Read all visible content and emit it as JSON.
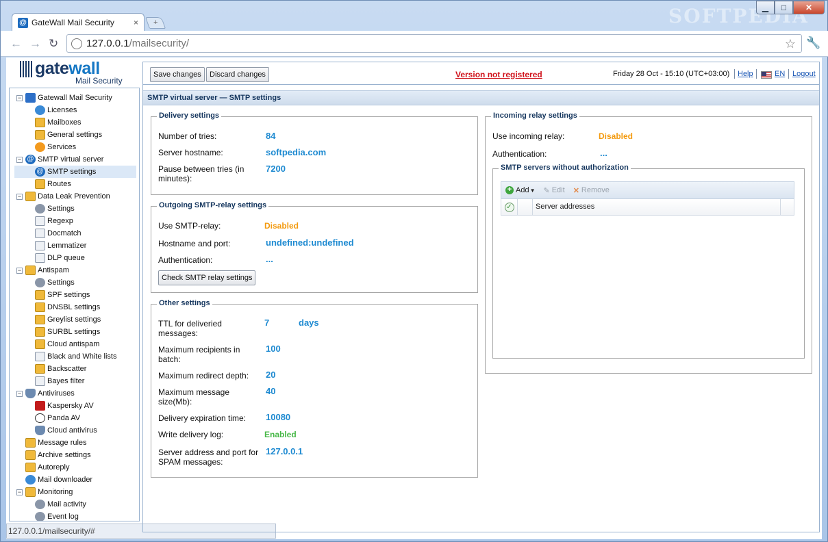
{
  "browser": {
    "tab_title": "GateWall Mail Security",
    "tab_close": "×",
    "new_tab": "+",
    "min": "▁",
    "max": "□",
    "close": "✕",
    "watermark": "SOFTPEDIA",
    "back": "←",
    "forward": "→",
    "reload": "↻",
    "url_host": "127.0.0.1",
    "url_path": "/mailsecurity/",
    "star": "☆",
    "wrench": "🔧",
    "status_url": "127.0.0.1/mailsecurity/#"
  },
  "logo": {
    "name_a": "gate",
    "name_b": "wall",
    "sub": "Mail Security"
  },
  "header": {
    "save": "Save changes",
    "discard": "Discard changes",
    "not_registered": "Version not registered",
    "datetime": "Friday 28 Oct - 15:10 (UTC+03:00)",
    "help": "Help",
    "lang": "EN",
    "logout": "Logout"
  },
  "tree": {
    "gatewall": "Gatewall Mail Security",
    "licenses": "Licenses",
    "mailboxes": "Mailboxes",
    "general": "General settings",
    "services": "Services",
    "smtp": "SMTP virtual server",
    "smtp_settings": "SMTP settings",
    "routes": "Routes",
    "dlp": "Data Leak Prevention",
    "dlp_settings": "Settings",
    "regexp": "Regexp",
    "docmatch": "Docmatch",
    "lemmatizer": "Lemmatizer",
    "dlp_queue": "DLP queue",
    "antispam": "Antispam",
    "as_settings": "Settings",
    "spf": "SPF settings",
    "dnsbl": "DNSBL settings",
    "greylist": "Greylist settings",
    "surbl": "SURBL settings",
    "cloud_antispam": "Cloud antispam",
    "bwlists": "Black and White lists",
    "backscatter": "Backscatter",
    "bayes": "Bayes filter",
    "antiviruses": "Antiviruses",
    "kaspersky": "Kaspersky AV",
    "panda": "Panda AV",
    "cloud_av": "Cloud antivirus",
    "message_rules": "Message rules",
    "archive": "Archive settings",
    "autoreply": "Autoreply",
    "downloader": "Mail downloader",
    "monitoring": "Monitoring",
    "mail_activity": "Mail activity",
    "event_log": "Event log"
  },
  "section_title": "SMTP virtual server — SMTP settings",
  "delivery": {
    "legend": "Delivery settings",
    "tries_label": "Number of tries:",
    "tries": "84",
    "host_label": "Server hostname:",
    "host": "softpedia.com",
    "pause_label": "Pause between tries (in minutes):",
    "pause": "7200"
  },
  "outgoing": {
    "legend": "Outgoing SMTP-relay settings",
    "use_label": "Use SMTP-relay:",
    "use": "Disabled",
    "hp_label": "Hostname and port:",
    "hp": "undefined:undefined",
    "auth_label": "Authentication:",
    "auth": "...",
    "check_btn": "Check SMTP relay settings"
  },
  "other": {
    "legend": "Other settings",
    "ttl_label": "TTL for deliveried messages:",
    "ttl": "7",
    "ttl_unit": "days",
    "maxrcpt_label": "Maximum recipients in batch:",
    "maxrcpt": "100",
    "redirect_label": "Maximum redirect depth:",
    "redirect": "20",
    "msgsize_label": "Maximum message size(Mb):",
    "msgsize": "40",
    "expire_label": "Delivery expiration time:",
    "expire": "10080",
    "log_label": "Write delivery log:",
    "log": "Enabled",
    "spam_label": "Server address and port for SPAM messages:",
    "spam": "127.0.0.1"
  },
  "incoming": {
    "legend": "Incoming relay settings",
    "use_label": "Use incoming relay:",
    "use": "Disabled",
    "auth_label": "Authentication:",
    "auth": "...",
    "servers_legend": "SMTP servers without authorization",
    "add": "Add",
    "edit": "Edit",
    "remove": "Remove",
    "col_header": "Server addresses"
  }
}
